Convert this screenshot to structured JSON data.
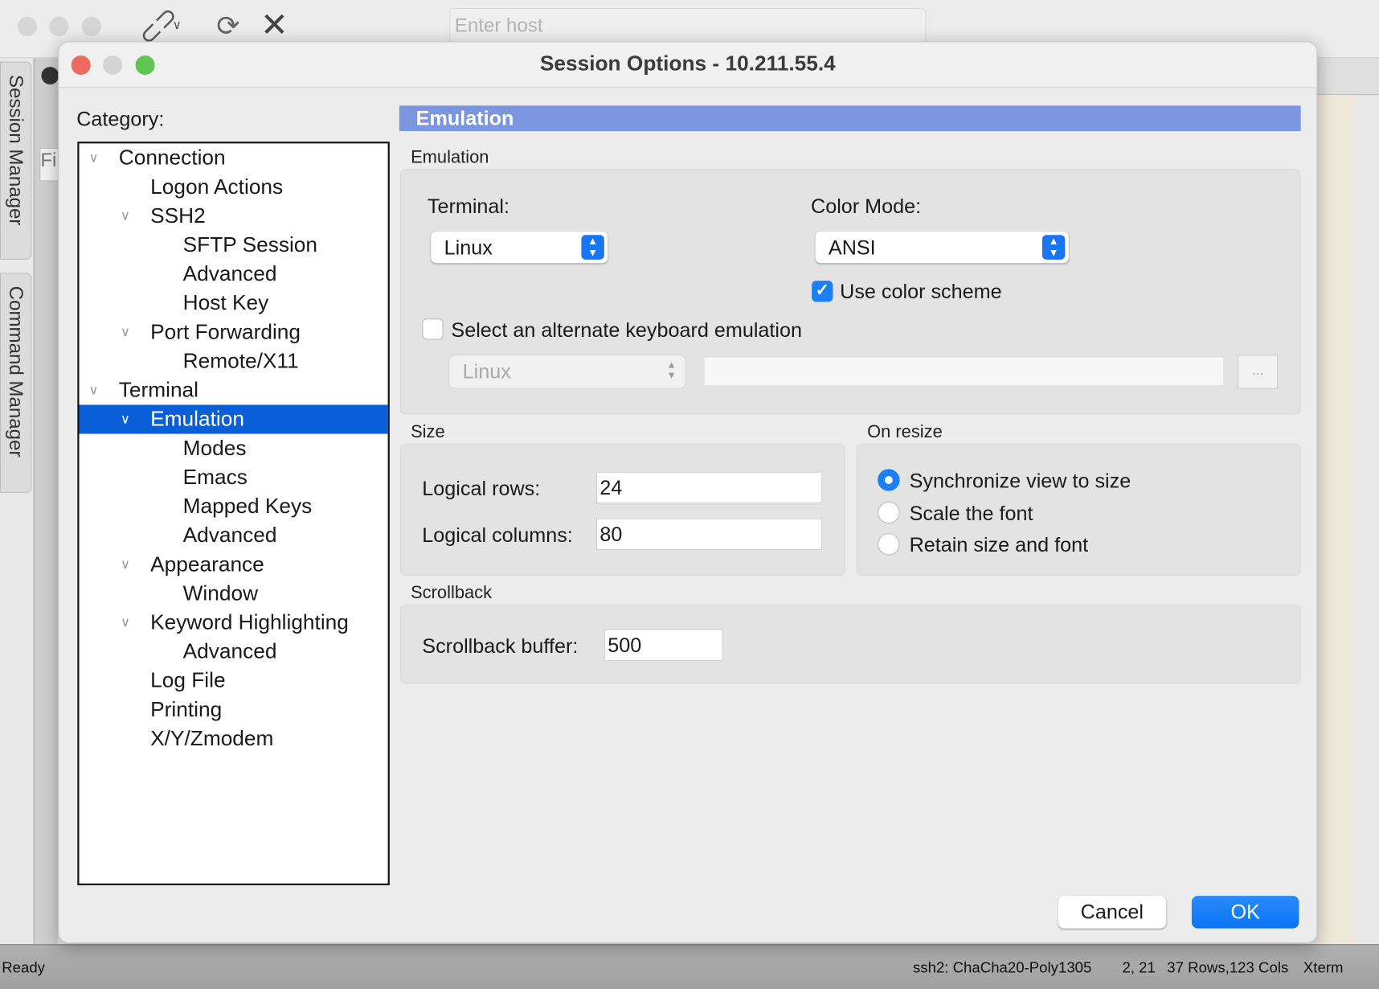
{
  "app": {
    "toolbar": {
      "host_placeholder": "Enter host",
      "icons": [
        "link-icon",
        "chevron-down-icon",
        "reconnect-icon",
        "close-icon"
      ]
    },
    "side_tabs": [
      "Session Manager",
      "Command Manager"
    ],
    "behind_fragment": "Fi",
    "status": {
      "left": "Ready",
      "cipher": "ssh2: ChaCha20-Poly1305",
      "cursor": "2, 21",
      "size": "37 Rows,123 Cols",
      "term": "Xterm"
    }
  },
  "dialog": {
    "title": "Session Options - 10.211.55.4",
    "category_label": "Category:",
    "tree": [
      {
        "label": "Connection",
        "level": 0,
        "expanded": true
      },
      {
        "label": "Logon Actions",
        "level": 1
      },
      {
        "label": "SSH2",
        "level": 1,
        "expanded": true
      },
      {
        "label": "SFTP Session",
        "level": 2
      },
      {
        "label": "Advanced",
        "level": 2
      },
      {
        "label": "Host Key",
        "level": 2
      },
      {
        "label": "Port Forwarding",
        "level": 1,
        "expanded": true
      },
      {
        "label": "Remote/X11",
        "level": 2
      },
      {
        "label": "Terminal",
        "level": 0,
        "expanded": true
      },
      {
        "label": "Emulation",
        "level": 1,
        "expanded": true,
        "selected": true
      },
      {
        "label": "Modes",
        "level": 2
      },
      {
        "label": "Emacs",
        "level": 2
      },
      {
        "label": "Mapped Keys",
        "level": 2
      },
      {
        "label": "Advanced",
        "level": 2
      },
      {
        "label": "Appearance",
        "level": 1,
        "expanded": true
      },
      {
        "label": "Window",
        "level": 2
      },
      {
        "label": "Keyword Highlighting",
        "level": 1,
        "expanded": true
      },
      {
        "label": "Advanced",
        "level": 2
      },
      {
        "label": "Log File",
        "level": 1
      },
      {
        "label": "Printing",
        "level": 1
      },
      {
        "label": "X/Y/Zmodem",
        "level": 1
      }
    ],
    "panel": {
      "header": "Emulation",
      "emulation": {
        "group": "Emulation",
        "terminal_label": "Terminal:",
        "terminal_value": "Linux",
        "color_mode_label": "Color Mode:",
        "color_mode_value": "ANSI",
        "use_color_scheme": {
          "label": "Use color scheme",
          "checked": true
        },
        "alt_keyboard": {
          "label": "Select an alternate keyboard emulation",
          "checked": false
        },
        "alt_keyboard_value": "Linux",
        "alt_keyboard_path": "",
        "browse_label": "..."
      },
      "size": {
        "group": "Size",
        "rows_label": "Logical rows:",
        "rows": "24",
        "cols_label": "Logical columns:",
        "cols": "80"
      },
      "on_resize": {
        "group": "On resize",
        "options": [
          "Synchronize view to size",
          "Scale the font",
          "Retain size and font"
        ],
        "selected": 0
      },
      "scrollback": {
        "group": "Scrollback",
        "label": "Scrollback buffer:",
        "value": "500"
      }
    },
    "buttons": {
      "cancel": "Cancel",
      "ok": "OK"
    },
    "colors": {
      "accent": "#0a5ed7",
      "header": "#7b96df",
      "ok": "#1b7ff5"
    }
  }
}
